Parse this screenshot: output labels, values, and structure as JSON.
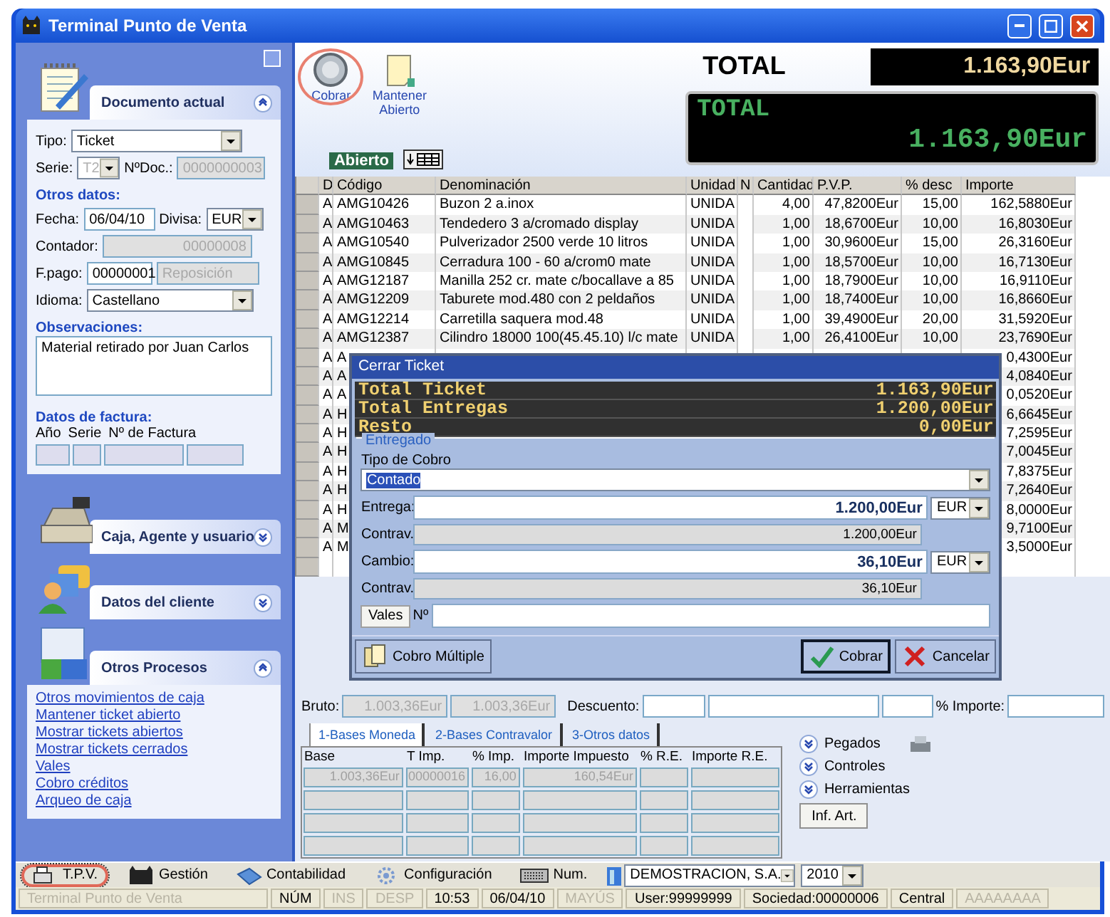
{
  "window": {
    "title": "Terminal Punto de Venta"
  },
  "left_panel": {
    "sections": [
      {
        "kind": "document",
        "title": "Documento actual",
        "expanded": true,
        "tipo": {
          "label": "Tipo:",
          "value": "Ticket"
        },
        "serie": {
          "label": "Serie:",
          "value": "T2",
          "disabled": true
        },
        "ndoc": {
          "label": "NºDoc.:",
          "value": "0000000003",
          "disabled": true
        },
        "otros_heading": "Otros datos:",
        "fecha": {
          "label": "Fecha:",
          "value": "06/04/10"
        },
        "divisa": {
          "label": "Divisa:",
          "value": "EUR"
        },
        "contador": {
          "label": "Contador:",
          "value": "00000008",
          "disabled": true
        },
        "fpago": {
          "label": "F.pago:",
          "value": "00000001",
          "extra": "Reposición",
          "disabled": true
        },
        "idioma": {
          "label": "Idioma:",
          "value": "Castellano"
        },
        "obs_heading": "Observaciones:",
        "observaciones": "Material retirado por Juan Carlos",
        "factura_heading": "Datos de factura:",
        "factura_columns": [
          "Año",
          "Serie",
          "Nº de Factura"
        ]
      },
      {
        "kind": "register",
        "title": "Caja, Agente y usuario",
        "expanded": false
      },
      {
        "kind": "customer",
        "title": "Datos del cliente",
        "expanded": false
      },
      {
        "kind": "processes",
        "title": "Otros Procesos",
        "expanded": true,
        "links": [
          "Otros movimientos de caja",
          "Mantener ticket abierto",
          "Mostrar tickets abiertos",
          "Mostrar tickets cerrados",
          "Vales",
          "Cobro créditos",
          "Arqueo de caja"
        ]
      }
    ]
  },
  "toolbar": {
    "buttons": [
      {
        "kind": "coin",
        "label": "Cobrar",
        "highlighted": true
      },
      {
        "kind": "note",
        "label": "Mantener Abierto",
        "highlighted": false
      }
    ],
    "status": "Abierto"
  },
  "totals": {
    "label": "TOTAL",
    "value": "1.163,90Eur",
    "display_label": "TOTAL",
    "display_value": "1.163,90Eur"
  },
  "table": {
    "columns": [
      "D",
      "Código",
      "Denominación",
      "Unidad",
      "N",
      "Cantidad",
      "P.V.P.",
      "% desc",
      "Importe"
    ],
    "rows": [
      {
        "d": "A",
        "codigo": "AMG10426",
        "denominacion": "Buzon 2 a.inox",
        "unidad": "UNIDA",
        "cantidad": "4,00",
        "pvp": "47,8200Eur",
        "desc": "15,00",
        "importe": "162,5880Eur"
      },
      {
        "d": "A",
        "codigo": "AMG10463",
        "denominacion": "Tendedero 3 a/cromado display",
        "unidad": "UNIDA",
        "cantidad": "1,00",
        "pvp": "18,6700Eur",
        "desc": "10,00",
        "importe": "16,8030Eur"
      },
      {
        "d": "A",
        "codigo": "AMG10540",
        "denominacion": "Pulverizador 2500 verde 10 litros",
        "unidad": "UNIDA",
        "cantidad": "1,00",
        "pvp": "30,9600Eur",
        "desc": "15,00",
        "importe": "26,3160Eur"
      },
      {
        "d": "A",
        "codigo": "AMG10845",
        "denominacion": "Cerradura 100 - 60 a/crom0 mate",
        "unidad": "UNIDA",
        "cantidad": "1,00",
        "pvp": "18,5700Eur",
        "desc": "10,00",
        "importe": "16,7130Eur"
      },
      {
        "d": "A",
        "codigo": "AMG12187",
        "denominacion": "Manilla 252 cr. mate c/bocallave a 85",
        "unidad": "UNIDA",
        "cantidad": "1,00",
        "pvp": "18,7900Eur",
        "desc": "10,00",
        "importe": "16,9110Eur"
      },
      {
        "d": "A",
        "codigo": "AMG12209",
        "denominacion": "Taburete mod.480 con 2 peldaños",
        "unidad": "UNIDA",
        "cantidad": "1,00",
        "pvp": "18,7400Eur",
        "desc": "10,00",
        "importe": "16,8660Eur"
      },
      {
        "d": "A",
        "codigo": "AMG12214",
        "denominacion": "Carretilla saquera mod.48",
        "unidad": "UNIDA",
        "cantidad": "1,00",
        "pvp": "39,4900Eur",
        "desc": "20,00",
        "importe": "31,5920Eur"
      },
      {
        "d": "A",
        "codigo": "AMG12387",
        "denominacion": "Cilindro 18000 100(45.45.10) l/c mate",
        "unidad": "UNIDA",
        "cantidad": "1,00",
        "pvp": "26,4100Eur",
        "desc": "10,00",
        "importe": "23,7690Eur"
      },
      {
        "d": "A",
        "codigo": "A",
        "importe": "0,4300Eur"
      },
      {
        "d": "A",
        "codigo": "A",
        "importe": "4,0840Eur"
      },
      {
        "d": "A",
        "codigo": "A",
        "importe": "0,0520Eur"
      },
      {
        "d": "A",
        "codigo": "H",
        "importe": "6,6645Eur"
      },
      {
        "d": "A",
        "codigo": "H",
        "importe": "7,2595Eur"
      },
      {
        "d": "A",
        "codigo": "H",
        "importe": "7,0045Eur"
      },
      {
        "d": "A",
        "codigo": "H",
        "importe": "7,8375Eur"
      },
      {
        "d": "A",
        "codigo": "H",
        "importe": "7,2640Eur"
      },
      {
        "d": "A",
        "codigo": "H",
        "importe": "8,0000Eur"
      },
      {
        "d": "A",
        "codigo": "M",
        "importe": "9,7100Eur"
      },
      {
        "d": "A",
        "codigo": "M",
        "importe": "3,5000Eur"
      }
    ]
  },
  "dialog": {
    "title": "Cerrar Ticket",
    "display": [
      {
        "label": "Total Ticket",
        "value": "1.163,90Eur"
      },
      {
        "label": "Total Entregas",
        "value": "1.200,00Eur"
      },
      {
        "label": "Resto",
        "value": "0,00Eur"
      }
    ],
    "group": "Entregado",
    "tipo_label": "Tipo de Cobro",
    "tipo_value": "Contado",
    "tipo_highlighted": true,
    "amounts": [
      {
        "label": "Entrega:",
        "value": "1.200,00Eur",
        "currency": "EUR",
        "contra_label": "Contrav.",
        "contra_value": "1.200,00Eur"
      },
      {
        "label": "Cambio:",
        "value": "36,10Eur",
        "currency": "EUR",
        "contra_label": "Contrav.",
        "contra_value": "36,10Eur"
      }
    ],
    "vales_button": "Vales",
    "vales_label": "Nº",
    "buttons": [
      {
        "kind": "multiple",
        "label": "Cobro Múltiple",
        "focused": false
      },
      {
        "kind": "ok",
        "label": "Cobrar",
        "focused": true
      },
      {
        "kind": "cancel",
        "label": "Cancelar",
        "focused": false
      }
    ]
  },
  "summary": {
    "bruto_label": "Bruto:",
    "bruto_values": [
      "1.003,36Eur",
      "1.003,36Eur"
    ],
    "descuento_label": "Descuento:",
    "importe_label": "% Importe:"
  },
  "tax_tabs": [
    {
      "label": "1-Bases Moneda",
      "selected": true
    },
    {
      "label": "2-Bases Contravalor",
      "selected": false
    },
    {
      "label": "3-Otros datos",
      "selected": false
    }
  ],
  "tax_table": {
    "columns": [
      "Base",
      "T Imp.",
      "% Imp.",
      "Importe Impuesto",
      "% R.E.",
      "Importe R.E."
    ],
    "rows": [
      [
        "1.003,36Eur",
        "00000016",
        "16,00",
        "160,54Eur",
        "",
        ""
      ],
      [
        "",
        "",
        "",
        "",
        "",
        ""
      ],
      [
        "",
        "",
        "",
        "",
        "",
        ""
      ],
      [
        "",
        "",
        "",
        "",
        "",
        ""
      ]
    ]
  },
  "expanders": [
    {
      "label": "Pegados",
      "expanded": false
    },
    {
      "label": "Controles",
      "expanded": false
    },
    {
      "label": "Herramientas",
      "expanded": false
    }
  ],
  "info_button": "Inf. Art.",
  "taskbar": {
    "items": [
      {
        "kind": "pos",
        "label": "T.P.V.",
        "selected": true
      },
      {
        "kind": "cat",
        "label": "Gestión",
        "selected": false
      },
      {
        "kind": "book",
        "label": "Contabilidad",
        "selected": false
      },
      {
        "kind": "config",
        "label": "Configuración",
        "selected": false
      },
      {
        "kind": "keyboard",
        "label": "Num.",
        "selected": false
      }
    ],
    "company": "DEMOSTRACION, S.A.",
    "year": "2010"
  },
  "status_bar": [
    {
      "text": "Terminal Punto de Venta",
      "disabled": true
    },
    {
      "text": "NÚM",
      "disabled": false
    },
    {
      "text": "INS",
      "disabled": true
    },
    {
      "text": "DESP",
      "disabled": true
    },
    {
      "text": "10:53",
      "disabled": false
    },
    {
      "text": "06/04/10",
      "disabled": false
    },
    {
      "text": "MAYÚS",
      "disabled": true
    },
    {
      "text": "User:99999999",
      "disabled": false
    },
    {
      "text": "Sociedad:00000006",
      "disabled": false
    },
    {
      "text": "Central",
      "disabled": false
    },
    {
      "text": "AAAAAAAA",
      "disabled": true
    }
  ]
}
